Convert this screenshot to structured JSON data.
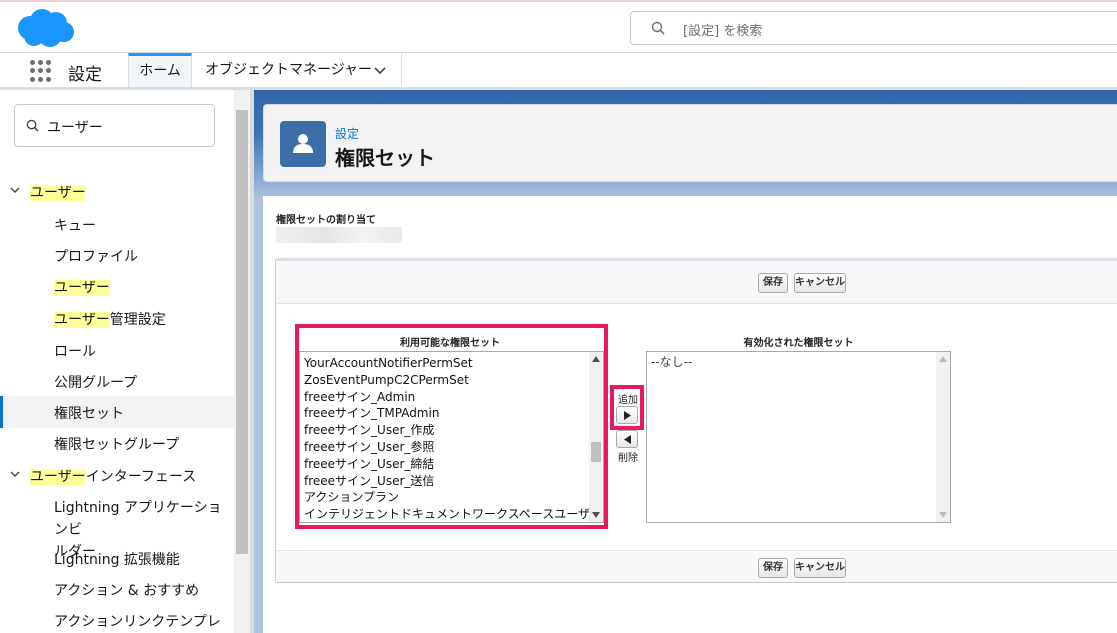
{
  "header": {
    "search_placeholder": "[設定] を検索"
  },
  "nav": {
    "app_name": "設定",
    "tabs": [
      {
        "label": "ホーム"
      },
      {
        "label": "オブジェクトマネージャー"
      }
    ]
  },
  "sidebar": {
    "search_value": "ユーザー",
    "items": [
      {
        "label": "ユーザー",
        "level": 1,
        "highlight": "ユーザー",
        "rest": ""
      },
      {
        "label": "キュー",
        "level": 2
      },
      {
        "label": "プロファイル",
        "level": 2
      },
      {
        "label": "ユーザー",
        "level": 2,
        "highlight": "ユーザー",
        "rest": ""
      },
      {
        "label": "ユーザー管理設定",
        "level": 2,
        "highlight": "ユーザー",
        "rest": "管理設定"
      },
      {
        "label": "ロール",
        "level": 2
      },
      {
        "label": "公開グループ",
        "level": 2
      },
      {
        "label": "権限セット",
        "level": 2,
        "selected": true
      },
      {
        "label": "権限セットグループ",
        "level": 2
      },
      {
        "label": "ユーザーインターフェース",
        "level": 1,
        "highlight": "ユーザー",
        "rest": "インターフェース"
      },
      {
        "label_line1": "Lightning アプリケーションビ",
        "label_line2": "ルダー",
        "level": 2
      },
      {
        "label": "Lightning 拡張機能",
        "level": 2
      },
      {
        "label": "アクション & おすすめ",
        "level": 2
      },
      {
        "label": "アクションリンクテンプレー",
        "level": 2
      }
    ]
  },
  "page_header": {
    "breadcrumb": "設定",
    "title": "権限セット"
  },
  "assignment": {
    "section_label": "権限セットの割り当て",
    "buttons": {
      "save": "保存",
      "cancel": "キャンセル"
    },
    "available": {
      "title": "利用可能な権限セット",
      "options": [
        "YourAccountNotifierPermSet",
        "ZosEventPumpC2CPermSet",
        "freeeサイン_Admin",
        "freeeサイン_TMPAdmin",
        "freeeサイン_User_作成",
        "freeeサイン_User_参照",
        "freeeサイン_User_締結",
        "freeeサイン_User_送信",
        "アクションプラン",
        "インテリジェントドキュメントワークスペースユーザー"
      ]
    },
    "enabled": {
      "title": "有効化された権限セット",
      "options": [
        "--なし--"
      ]
    },
    "add_label": "追加",
    "remove_label": "削除"
  },
  "colors": {
    "accent": "#0176d3",
    "highlight": "#ffff99",
    "annotation": "#e8195f",
    "header_band": "#2f65a8"
  }
}
